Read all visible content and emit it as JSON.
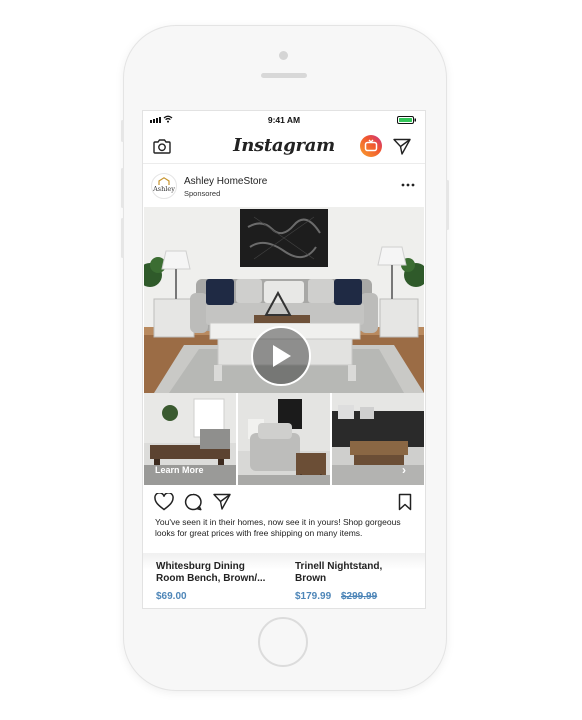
{
  "status_bar": {
    "time": "9:41 AM"
  },
  "app": {
    "logo_text": "Instagram"
  },
  "post": {
    "brand_name": "Ashley HomeStore",
    "brand_avatar_text": "Ashley",
    "sponsored_label": "Sponsored",
    "learn_more_label": "Learn More",
    "caption": "You've seen it in their homes, now see it in yours! Shop gorgeous looks for great prices with free shipping on many items."
  },
  "products": [
    {
      "name_line1": "Whitesburg Dining",
      "name_line2": "Room Bench, Brown/...",
      "price": "$69.00"
    },
    {
      "name_line1": "Trinell Nightstand,",
      "name_line2": "Brown",
      "price": "$179.99",
      "old_price": "$299.99"
    }
  ],
  "colors": {
    "price_blue": "#4e86b8",
    "story_ring": "#f27a1a"
  },
  "icons": [
    "camera-icon",
    "igtv-icon",
    "direct-message-icon",
    "more-options-icon",
    "play-icon",
    "heart-icon",
    "comment-icon",
    "share-icon",
    "bookmark-icon",
    "chevron-right-icon"
  ]
}
